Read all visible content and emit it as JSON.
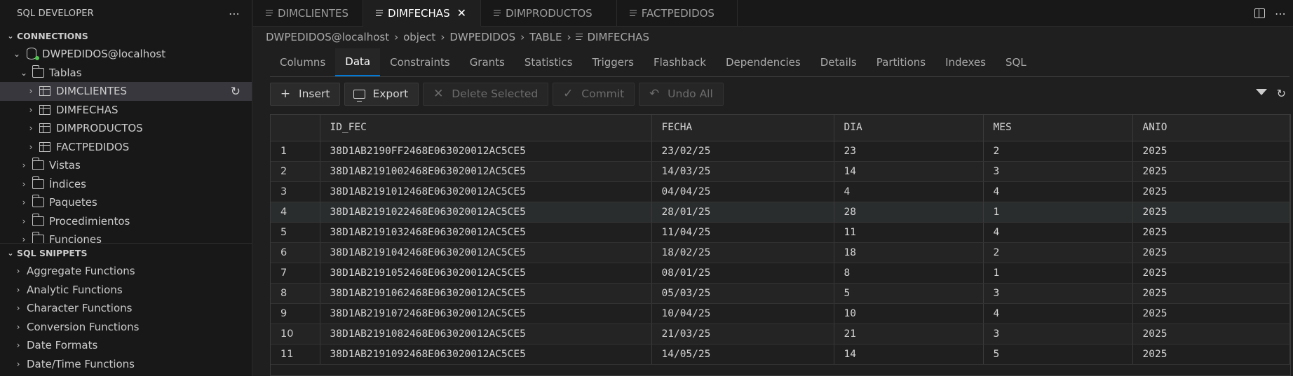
{
  "sidebar": {
    "title": "SQL DEVELOPER",
    "more": "⋯",
    "connections_label": "CONNECTIONS",
    "connection_name": "DWPEDIDOS@localhost",
    "tables_label": "Tablas",
    "tables": [
      "DIMCLIENTES",
      "DIMFECHAS",
      "DIMPRODUCTOS",
      "FACTPEDIDOS"
    ],
    "folders": [
      "Vistas",
      "Índices",
      "Paquetes",
      "Procedimientos",
      "Funciones"
    ],
    "snippets_label": "SQL SNIPPETS",
    "snippets": [
      "Aggregate Functions",
      "Analytic Functions",
      "Character Functions",
      "Conversion Functions",
      "Date Formats",
      "Date/Time Functions"
    ]
  },
  "tabs": [
    {
      "label": "DIMCLIENTES",
      "active": false
    },
    {
      "label": "DIMFECHAS",
      "active": true
    },
    {
      "label": "DIMPRODUCTOS",
      "active": false
    },
    {
      "label": "FACTPEDIDOS",
      "active": false
    }
  ],
  "breadcrumb": [
    "DWPEDIDOS@localhost",
    "object",
    "DWPEDIDOS",
    "TABLE",
    "DIMFECHAS"
  ],
  "subtabs": [
    "Columns",
    "Data",
    "Constraints",
    "Grants",
    "Statistics",
    "Triggers",
    "Flashback",
    "Dependencies",
    "Details",
    "Partitions",
    "Indexes",
    "SQL"
  ],
  "active_subtab": "Data",
  "toolbar": {
    "insert": "Insert",
    "export": "Export",
    "delete_selected": "Delete Selected",
    "commit": "Commit",
    "undo_all": "Undo All"
  },
  "grid": {
    "columns": [
      "ID_FEC",
      "FECHA",
      "DIA",
      "MES",
      "ANIO"
    ],
    "rows": [
      [
        "1",
        "38D1AB2190FF2468E063020012AC5CE5",
        "23/02/25",
        "23",
        "2",
        "2025"
      ],
      [
        "2",
        "38D1AB2191002468E063020012AC5CE5",
        "14/03/25",
        "14",
        "3",
        "2025"
      ],
      [
        "3",
        "38D1AB2191012468E063020012AC5CE5",
        "04/04/25",
        "4",
        "4",
        "2025"
      ],
      [
        "4",
        "38D1AB2191022468E063020012AC5CE5",
        "28/01/25",
        "28",
        "1",
        "2025"
      ],
      [
        "5",
        "38D1AB2191032468E063020012AC5CE5",
        "11/04/25",
        "11",
        "4",
        "2025"
      ],
      [
        "6",
        "38D1AB2191042468E063020012AC5CE5",
        "18/02/25",
        "18",
        "2",
        "2025"
      ],
      [
        "7",
        "38D1AB2191052468E063020012AC5CE5",
        "08/01/25",
        "8",
        "1",
        "2025"
      ],
      [
        "8",
        "38D1AB2191062468E063020012AC5CE5",
        "05/03/25",
        "5",
        "3",
        "2025"
      ],
      [
        "9",
        "38D1AB2191072468E063020012AC5CE5",
        "10/04/25",
        "10",
        "4",
        "2025"
      ],
      [
        "10",
        "38D1AB2191082468E063020012AC5CE5",
        "21/03/25",
        "21",
        "3",
        "2025"
      ],
      [
        "11",
        "38D1AB2191092468E063020012AC5CE5",
        "14/05/25",
        "14",
        "5",
        "2025"
      ]
    ]
  },
  "colors": {
    "accent": "#0078d4",
    "selected_row": "#37373d",
    "connection_status": "#4ec94e"
  }
}
